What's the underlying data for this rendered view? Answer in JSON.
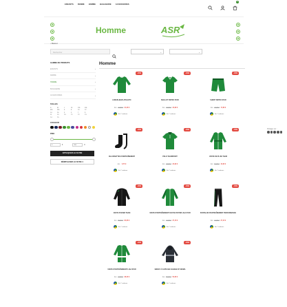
{
  "nav": {
    "items": [
      "ENFANTS",
      "FEMME",
      "HOMME",
      "BAGAGERIE",
      "ACCESSOIRES"
    ]
  },
  "header": {
    "cart_count": "0",
    "icons": [
      "search-icon",
      "user-icon",
      "cart-icon"
    ]
  },
  "banner": {
    "title": "Homme"
  },
  "back": {
    "label": "Retour"
  },
  "search": {
    "placeholder": "Rechercher"
  },
  "sidebar": {
    "categories_title": "GAMME DE PRODUITS",
    "categories": [
      {
        "label": "ENFANTS",
        "active": false
      },
      {
        "label": "FEMME",
        "active": false
      },
      {
        "label": "HOMME",
        "active": true
      },
      {
        "label": "BAGAGERIE",
        "active": false
      },
      {
        "label": "ACCESSOIRES",
        "active": false
      }
    ],
    "sizes_title": "TAILLES",
    "sizes": [
      "S",
      "M",
      "L",
      "XL",
      "2XL",
      "3XL",
      "4XL",
      "5XL",
      "6",
      "8",
      "10",
      "12",
      "14",
      "16",
      "3",
      "5",
      "7",
      "9",
      "11",
      "13",
      "T0",
      "T1",
      "T2",
      "T3",
      "T4",
      "T5"
    ],
    "colors_title": "COULEUR",
    "colors": [
      "#111111",
      "#1a2a5a",
      "#7a1f2b",
      "#3a8e2e",
      "#6ab743",
      "#4a4a9a",
      "#c62e8b",
      "#d9363e",
      "#f08a24",
      "#ffffff",
      "#f2d33a"
    ],
    "price_title": "PRIX",
    "price_min": "0",
    "price_max": "200",
    "currency": "€",
    "apply_label": "APPLIQUER LE FILTRE",
    "reset_label": "RÉINITIALISER LE FILTRE"
  },
  "main": {
    "title": "Homme"
  },
  "products": [
    {
      "name": "LONGSLEEVE ATHLETIC",
      "badge": "-15%",
      "old": "24,95 €",
      "new": "21,20 €",
      "colors": "En 7 couleurs",
      "type": "longsleeve"
    },
    {
      "name": "MAILLOT RETRO STAR",
      "badge": "-15%",
      "old": "26,95 €",
      "new": "22,90 €",
      "colors": "En 7 couleurs",
      "type": "jersey"
    },
    {
      "name": "SHORT RETRO STAR",
      "badge": "-15%",
      "old": "20,95 €",
      "new": "17,80 €",
      "colors": "En 7 couleurs",
      "type": "shorts"
    },
    {
      "name": "CHAUSSETTES D'ENTRAÎNEMENT",
      "badge": "-15%",
      "old": "",
      "new": "6,75 €",
      "colors": "En 7 couleurs",
      "type": "socks"
    },
    {
      "name": "POLO TEAMSPORT",
      "badge": "-15%",
      "old": "26,95 €",
      "new": "22,90 €",
      "colors": "En 7 couleurs",
      "type": "polo"
    },
    {
      "name": "VESTE DE PLUIE TEAM",
      "badge": "-15%",
      "old": "52,95 €",
      "new": "44,95 €",
      "colors": "En 7 couleurs",
      "type": "jacket"
    },
    {
      "name": "VESTE D'HIVER TEAM",
      "badge": "-15%",
      "old": "99,95 €",
      "new": "84,95 €",
      "colors": "En 7 couleurs",
      "type": "winter"
    },
    {
      "name": "VESTE D'ENTRAÎNEMENT EN POLYESTER LIGA STAR",
      "badge": "-15%",
      "old": "31,95 €",
      "new": "27,15 €",
      "colors": "En 7 couleurs",
      "type": "tracktop"
    },
    {
      "name": "PANTALON D'ENTRAÎNEMENT PERFORMANCE",
      "badge": "-15%",
      "old": "31,95 €",
      "new": "27,15 €",
      "colors": "En 7 couleurs",
      "type": "pants"
    },
    {
      "name": "VESTE D'ENTRAÎNEMENT LIGA STAR",
      "badge": "-15%",
      "old": "44,95 €",
      "new": "38,20 €",
      "colors": "En 7 couleurs",
      "type": "tracktop2"
    },
    {
      "name": "SWEAT À CAPUCHE CHANGE BY ERIMA",
      "badge": "-15%",
      "old": "59,95 €",
      "new": "50,95 €",
      "colors": "En 7 couleurs",
      "type": "hoodie"
    }
  ],
  "card_labels": {
    "price_label": "dès"
  },
  "share": {
    "label": "Partager sur :"
  }
}
